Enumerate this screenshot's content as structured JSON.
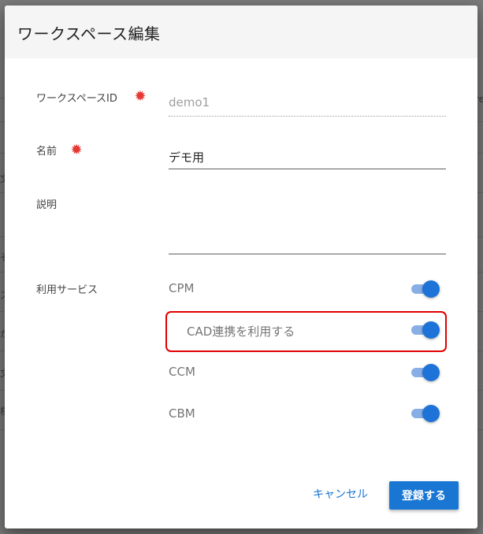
{
  "dialog": {
    "title": "ワークスペース編集"
  },
  "fields": {
    "workspace_id": {
      "label": "ワークスペースID",
      "value": "demo1"
    },
    "name": {
      "label": "名前",
      "value": "デモ用"
    },
    "description": {
      "label": "説明",
      "value": ""
    },
    "services": {
      "label": "利用サービス"
    }
  },
  "services": [
    {
      "label": "CPM",
      "enabled": true
    },
    {
      "label": "CAD連携を利用する",
      "enabled": true
    },
    {
      "label": "CCM",
      "enabled": true
    },
    {
      "label": "CBM",
      "enabled": true
    }
  ],
  "buttons": {
    "cancel": "キャンセル",
    "submit": "登録する"
  },
  "background_fragments": [
    "re",
    "文",
    "ぞ",
    "ス",
    "が",
    "文",
    "桜"
  ],
  "colors": {
    "accent": "#1976d2",
    "required": "#e53935",
    "highlight": "#e00000",
    "toggle_track": "#88aee6",
    "toggle_thumb": "#1e73d8"
  }
}
